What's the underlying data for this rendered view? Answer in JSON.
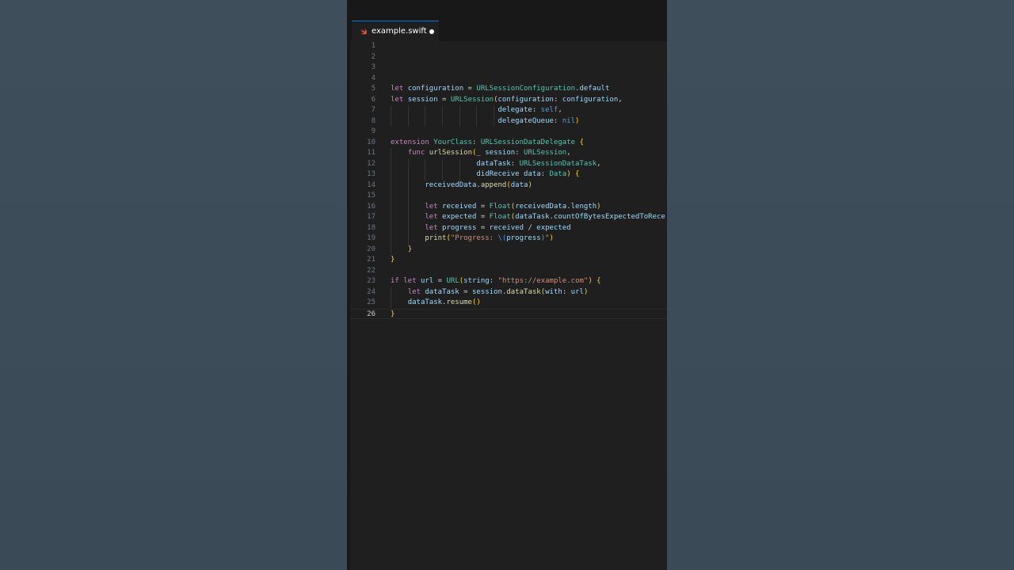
{
  "tab": {
    "filename": "example.swift",
    "icon": "swift-icon"
  },
  "colors": {
    "accent": "#0078d4",
    "editor_bg": "#1f1f1f",
    "outer_bg": "#3d4e5a"
  },
  "active_line": 26,
  "lines": [
    {
      "n": "1",
      "code": ""
    },
    {
      "n": "2",
      "code": ""
    },
    {
      "n": "3",
      "code": ""
    },
    {
      "n": "4",
      "code": ""
    },
    {
      "n": "5",
      "code": "let configuration = URLSessionConfiguration.default"
    },
    {
      "n": "6",
      "code": "let session = URLSession(configuration: configuration,"
    },
    {
      "n": "7",
      "code": "                         delegate: self,"
    },
    {
      "n": "8",
      "code": "                         delegateQueue: nil)"
    },
    {
      "n": "9",
      "code": ""
    },
    {
      "n": "10",
      "code": "extension YourClass: URLSessionDataDelegate {"
    },
    {
      "n": "11",
      "code": "    func urlSession(_ session: URLSession,"
    },
    {
      "n": "12",
      "code": "                    dataTask: URLSessionDataTask,"
    },
    {
      "n": "13",
      "code": "                    didReceive data: Data) {"
    },
    {
      "n": "14",
      "code": "        receivedData.append(data)"
    },
    {
      "n": "15",
      "code": ""
    },
    {
      "n": "16",
      "code": "        let received = Float(receivedData.length)"
    },
    {
      "n": "17",
      "code": "        let expected = Float(dataTask.countOfBytesExpectedToRece:"
    },
    {
      "n": "18",
      "code": "        let progress = received / expected"
    },
    {
      "n": "19",
      "code": "        print(\"Progress: \\(progress)\")"
    },
    {
      "n": "20",
      "code": "    }"
    },
    {
      "n": "21",
      "code": "}"
    },
    {
      "n": "22",
      "code": ""
    },
    {
      "n": "23",
      "code": "if let url = URL(string: \"https://example.com\") {"
    },
    {
      "n": "24",
      "code": "    let dataTask = session.dataTask(with: url)"
    },
    {
      "n": "25",
      "code": "    dataTask.resume()"
    },
    {
      "n": "26",
      "code": "}"
    }
  ]
}
